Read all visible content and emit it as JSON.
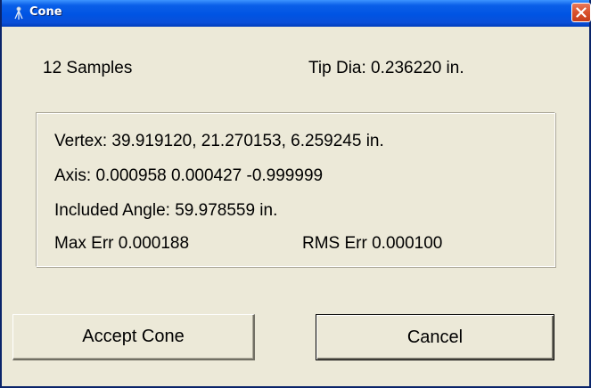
{
  "window": {
    "title": "Cone",
    "icon": "cone-app-icon",
    "close_icon": "close-icon"
  },
  "summary": {
    "samples": "12 Samples",
    "tip_dia": "Tip Dia: 0.236220 in."
  },
  "results": {
    "vertex": "Vertex: 39.919120, 21.270153, 6.259245 in.",
    "axis": "Axis: 0.000958 0.000427 -0.999999",
    "included_angle": "Included Angle: 59.978559 in.",
    "max_err": "Max Err 0.000188",
    "rms_err": "RMS Err 0.000100"
  },
  "buttons": {
    "accept": "Accept Cone",
    "cancel": "Cancel"
  }
}
